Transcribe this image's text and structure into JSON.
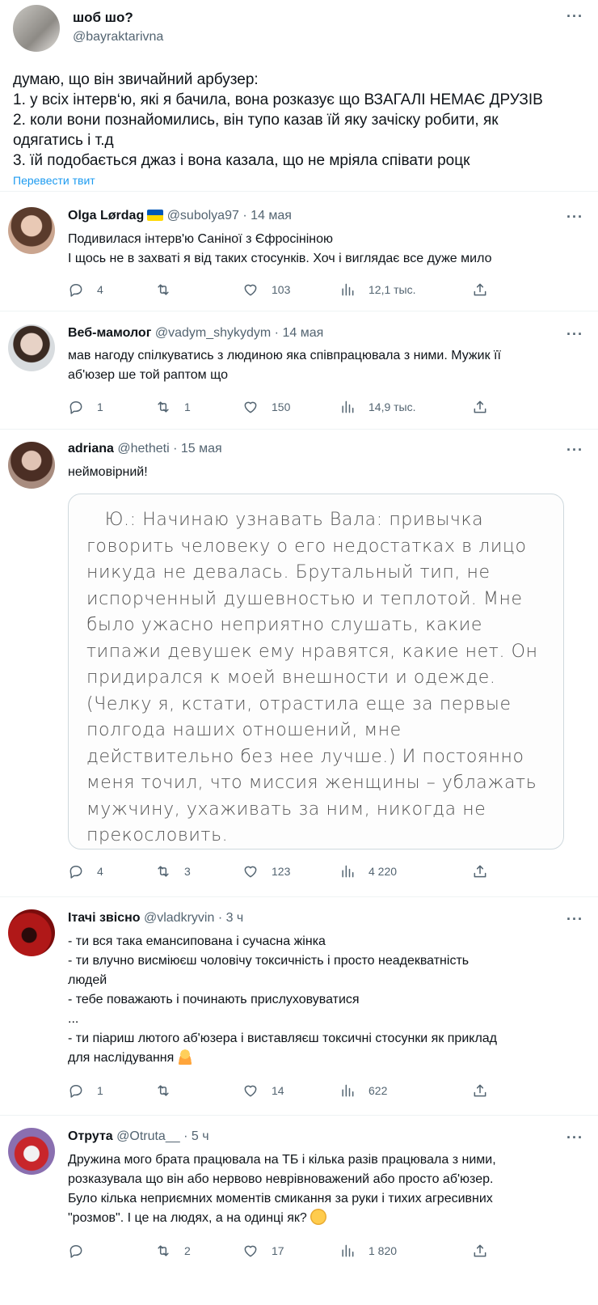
{
  "main": {
    "name": "шоб шо?",
    "handle": "@bayraktarivna",
    "lines": [
      "думаю, що він звичайний арбузер:",
      "1. у всіх інтерв‘ю, які я бачила, вона розказує що ВЗАГАЛІ НЕМАЄ ДРУЗІВ",
      "2. коли вони познайомились, він тупо казав їй яку зачіску робити, як",
      "одягатись і т.д",
      "3. їй подобається джаз і вона казала, що не мріяла співати роцк"
    ],
    "translate": "Перевести твит",
    "more": "···"
  },
  "replies": [
    {
      "name": "Olga Lørdag",
      "handle": "@subolya97",
      "date": "· 14 мая",
      "lines": [
        "Подивилася інтерв'ю Саніної з Єфросініною",
        "І щось не в захваті я від таких стосунків. Хоч і виглядає все дуже мило"
      ],
      "replies": "4",
      "retweets": "",
      "likes": "103",
      "views": "12,1 тыс."
    },
    {
      "name": "Веб-мамолог",
      "handle": "@vadym_shykydym",
      "date": "· 14 мая",
      "lines": [
        "мав нагоду спілкуватись з людиною яка співпрацювала з ними. Мужик її",
        "аб'юзер ше той раптом що"
      ],
      "replies": "1",
      "retweets": "1",
      "likes": "150",
      "views": "14,9 тыс."
    },
    {
      "name": "adriana",
      "handle": "@hetheti",
      "date": "· 15 мая",
      "lines": [
        "неймовірний!"
      ],
      "quote_lines": [
        "   Ю.: Начинаю узнавать Вала: привычка",
        "говорить человеку о его недостатках в лицо",
        "никуда не девалась. Брутальный тип, не",
        "испорченный душевностью и теплотой. Мне",
        "было ужасно неприятно слушать, какие",
        "типажи девушек ему нравятся, какие нет. Он",
        "придирался к моей внешности и одежде.",
        "(Челку я, кстати, отрастила еще за первые",
        "полгода наших отношений, мне",
        "действительно без нее лучше.) И постоянно",
        "меня точил, что миссия женщины – ублажать",
        "мужчину, ухаживать за ним, никогда не",
        "прекословить."
      ],
      "replies": "4",
      "retweets": "3",
      "likes": "123",
      "views": "4 220"
    },
    {
      "name": "Ітачі звісно",
      "handle": "@vladkryvin",
      "date": "· 3 ч",
      "lines": [
        "- ти вся така емансипована і сучасна жінка",
        "- ти влучно висміюєш чоловічу токсичність і просто неадекватність",
        "людей",
        "- тебе поважають і починають прислуховуватися",
        "...",
        "- ти піариш лютого аб'юзера і виставляєш токсичні стосунки як приклад",
        "для наслідування"
      ],
      "replies": "1",
      "retweets": "",
      "likes": "14",
      "views": "622"
    },
    {
      "name": "Отрута",
      "handle": "@Otruta__",
      "date": "· 5 ч",
      "lines": [
        "Дружина мого брата працювала на ТБ і кілька разів працювала з ними,",
        "розказувала що він або нервово неврівноважений або просто аб'юзер.",
        "Було кілька неприємних моментів смикання за руки і тихих агресивних",
        "\"розмов\". І це на людях, а на одинці як?"
      ],
      "replies": "",
      "retweets": "2",
      "likes": "17",
      "views": "1 820"
    }
  ]
}
